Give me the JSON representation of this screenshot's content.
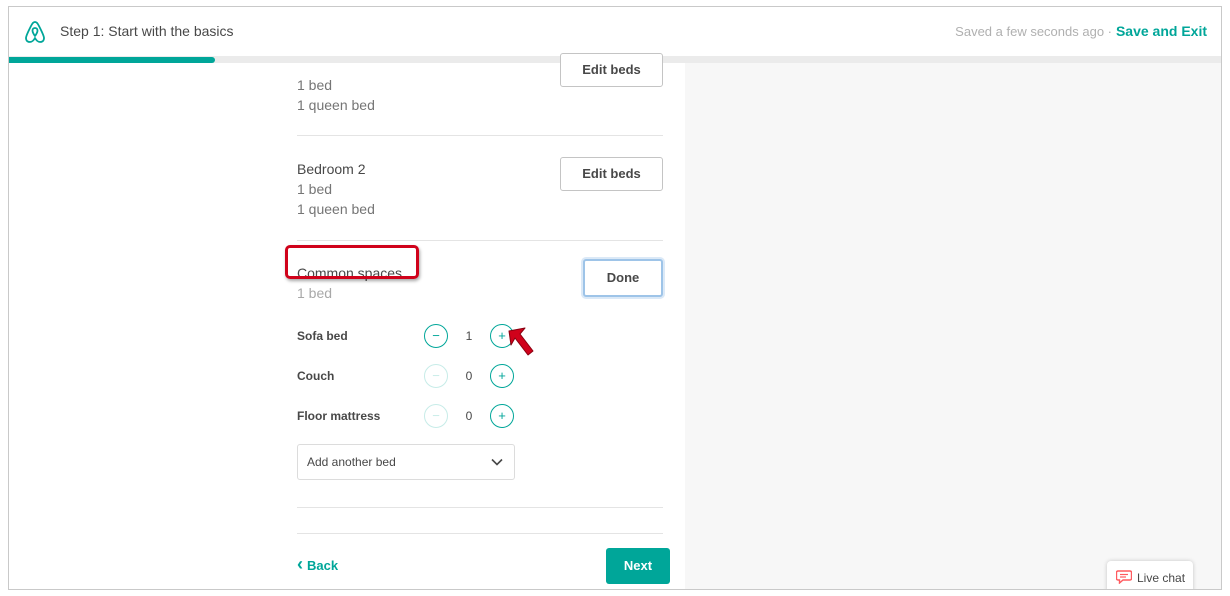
{
  "header": {
    "step_title": "Step 1: Start with the basics",
    "saved_status": "Saved a few seconds ago ·",
    "save_exit_label": "Save and Exit",
    "brand_color": "#00a699"
  },
  "progress": {
    "percent": 17
  },
  "rooms": {
    "bedroom1": {
      "line1": "1 bed",
      "line2": "1 queen bed",
      "button": "Edit beds"
    },
    "bedroom2": {
      "title": "Bedroom 2",
      "line1": "1 bed",
      "line2": "1 queen bed",
      "button": "Edit beds"
    },
    "common": {
      "title": "Common spaces",
      "summary": "1 bed",
      "done_label": "Done",
      "beds": [
        {
          "label": "Sofa bed",
          "value": "1"
        },
        {
          "label": "Couch",
          "value": "0"
        },
        {
          "label": "Floor mattress",
          "value": "0"
        }
      ],
      "add_bed_label": "Add another bed"
    }
  },
  "footer": {
    "back_label": "Back",
    "next_label": "Next"
  },
  "live_chat": {
    "label": "Live chat"
  },
  "icons": {
    "logo": "airbnb-logo-icon",
    "minus": "−",
    "plus": "+",
    "chevron": "chevron-down-icon",
    "back_chevron": "‹"
  }
}
